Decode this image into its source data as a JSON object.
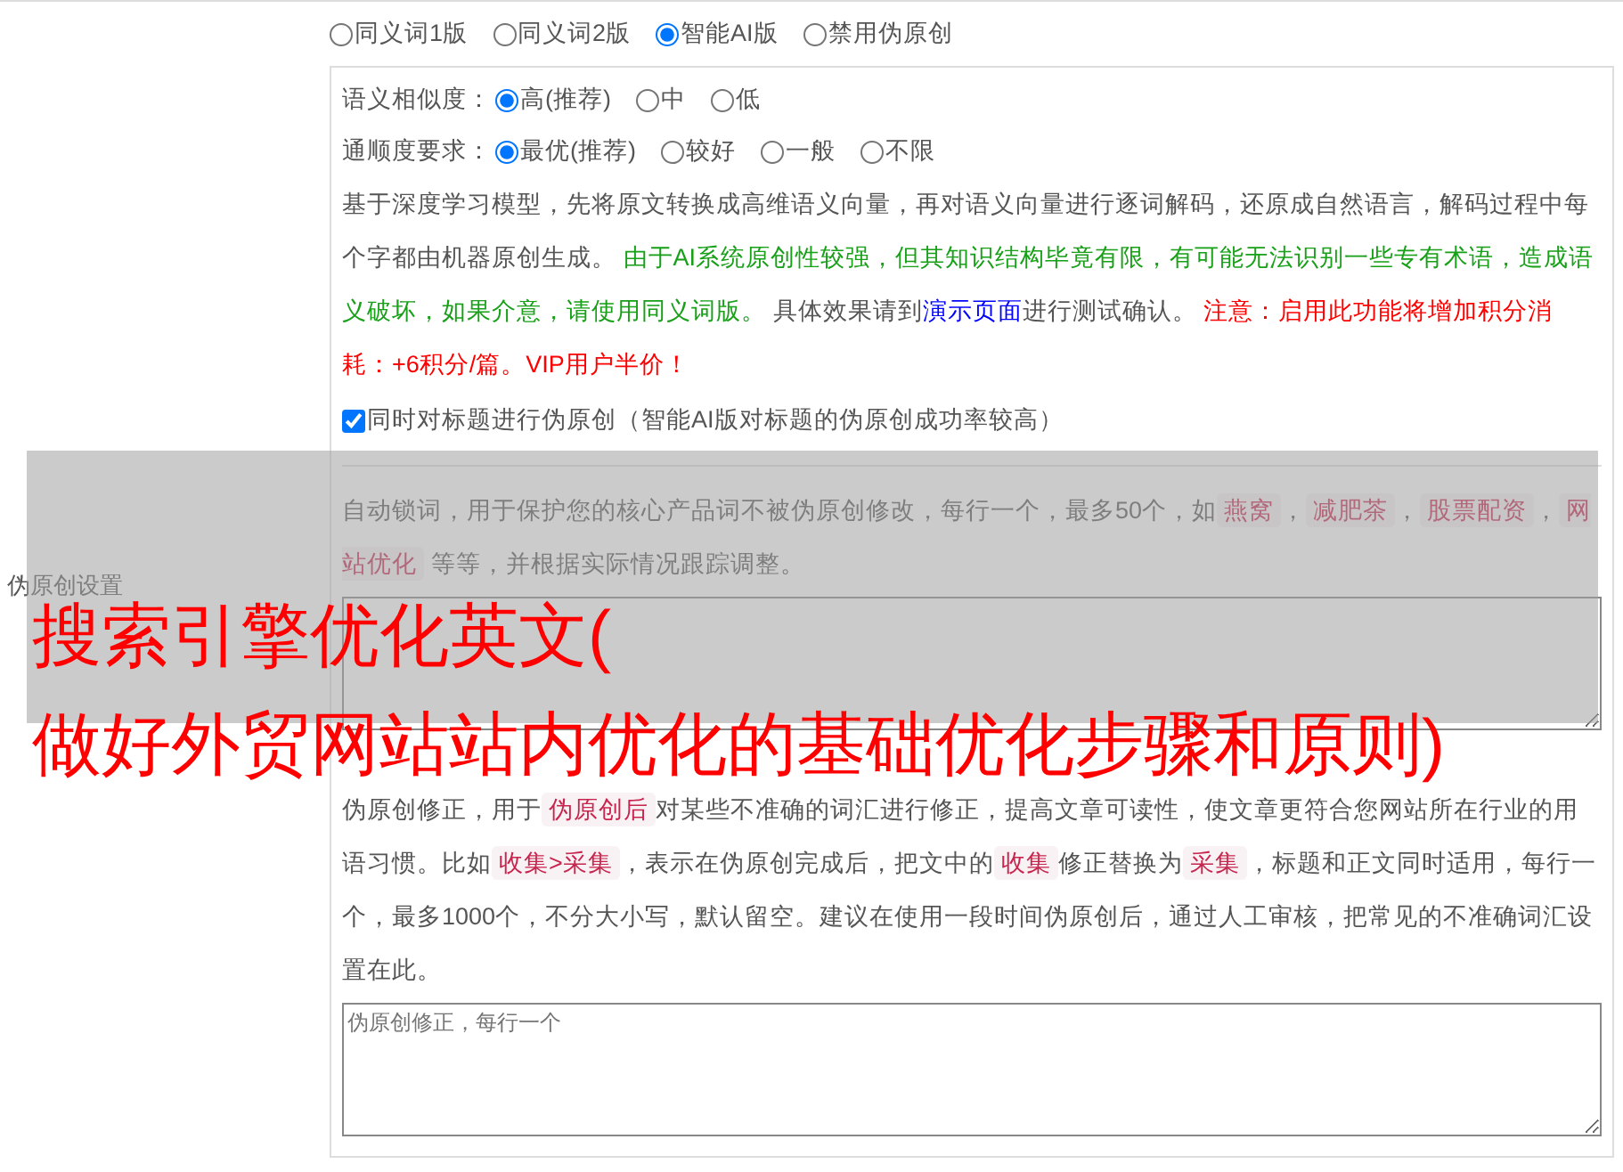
{
  "sidebar_label": "伪原创设置",
  "mode_options": [
    {
      "label": "同义词1版",
      "selected": false
    },
    {
      "label": "同义词2版",
      "selected": false
    },
    {
      "label": "智能AI版",
      "selected": true
    },
    {
      "label": "禁用伪原创",
      "selected": false
    }
  ],
  "similarity": {
    "label": "语义相似度：",
    "options": [
      {
        "label": "高(推荐)",
        "selected": true
      },
      {
        "label": "中",
        "selected": false
      },
      {
        "label": "低",
        "selected": false
      }
    ]
  },
  "fluency": {
    "label": "通顺度要求：",
    "options": [
      {
        "label": "最优(推荐)",
        "selected": true
      },
      {
        "label": "较好",
        "selected": false
      },
      {
        "label": "一般",
        "selected": false
      },
      {
        "label": "不限",
        "selected": false
      }
    ]
  },
  "ai_description": [
    {
      "kind": "plain",
      "text": "基于深度学习模型，先将原文转换成高维语义向量，再对语义向量进行逐词解码，还原成自然语言，解码过程中每个字都由机器原创生成。 "
    },
    {
      "kind": "green",
      "text": "由于AI系统原创性较强，但其知识结构毕竟有限，有可能无法识别一些专有术语，造成语义破坏，如果介意，请使用同义词版。"
    },
    {
      "kind": "plain",
      "text": " 具体效果请到"
    },
    {
      "kind": "link",
      "text": "演示页面"
    },
    {
      "kind": "plain",
      "text": "进行测试确认。 "
    },
    {
      "kind": "red",
      "text": "注意：启用此功能将增加积分消耗：+6积分/篇。VIP用户半价！"
    }
  ],
  "title_checkbox": {
    "label": "同时对标题进行伪原创（智能AI版对标题的伪原创成功率较高）",
    "checked": true
  },
  "lock_words": {
    "description": [
      {
        "kind": "plain",
        "text": "自动锁词，用于保护您的核心产品词不被伪原创修改，每行一个，最多50个，如"
      },
      {
        "kind": "tag",
        "text": "燕窝"
      },
      {
        "kind": "plain",
        "text": "，"
      },
      {
        "kind": "tag",
        "text": "减肥茶"
      },
      {
        "kind": "plain",
        "text": "，"
      },
      {
        "kind": "tag",
        "text": "股票配资"
      },
      {
        "kind": "plain",
        "text": "，"
      },
      {
        "kind": "tag",
        "text": "网站优化"
      },
      {
        "kind": "plain",
        "text": " 等等，并根据实际情况跟踪调整。"
      }
    ]
  },
  "correction": {
    "description": [
      {
        "kind": "plain",
        "text": "伪原创修正，用于"
      },
      {
        "kind": "tag",
        "text": "伪原创后"
      },
      {
        "kind": "plain",
        "text": "对某些不准确的词汇进行修正，提高文章可读性，使文章更符合您网站所在行业的用语习惯。比如"
      },
      {
        "kind": "tag",
        "text": "收集>采集"
      },
      {
        "kind": "plain",
        "text": "，表示在伪原创完成后，把文中的"
      },
      {
        "kind": "tag",
        "text": "收集"
      },
      {
        "kind": "plain",
        "text": "修正替换为"
      },
      {
        "kind": "tag",
        "text": "采集"
      },
      {
        "kind": "plain",
        "text": "，标题和正文同时适用，每行一个，最多1000个，不分大小写，默认留空。建议在使用一段时间伪原创后，通过人工审核，把常见的不准确词汇设置在此。"
      }
    ],
    "placeholder": "伪原创修正，每行一个"
  },
  "overlay_title": [
    "搜索引擎优化英文(",
    "做好外贸网站站内优化的基础优化步骤和原则)"
  ]
}
